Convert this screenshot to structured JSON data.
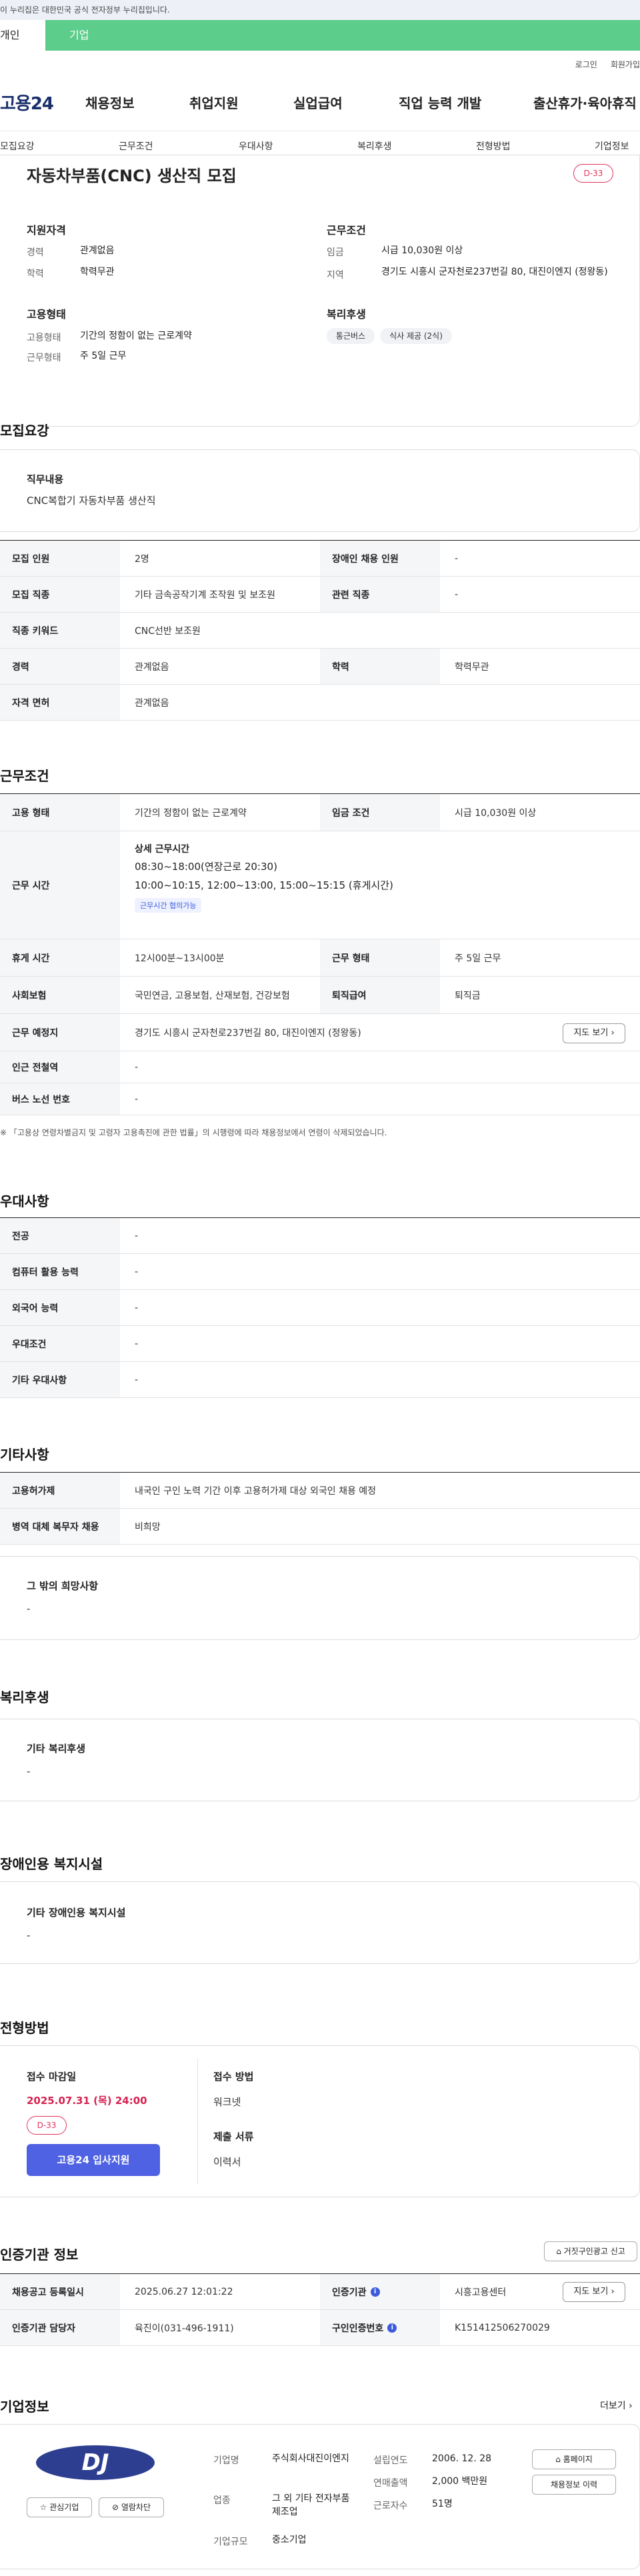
{
  "banner": {
    "text": "이 누리집은 대한민국 공식 전자정부 누리집입니다."
  },
  "tabs": {
    "person": "개인",
    "company": "기업"
  },
  "util": {
    "login": "로그인",
    "join": "회원가입"
  },
  "logo": "고용24",
  "gnb": [
    "채용정보",
    "취업지원",
    "실업급여",
    "직업 능력 개발",
    "출산휴가·육아휴직"
  ],
  "snb": [
    "모집요강",
    "근무조건",
    "우대사항",
    "복리후생",
    "전형방법",
    "기업정보"
  ],
  "job": {
    "title": "자동차부품(CNC) 생산직 모집",
    "dday": "D-33",
    "qual_label": "지원자격",
    "career_k": "경력",
    "career_v": "관계없음",
    "edu_k": "학력",
    "edu_v": "학력무관",
    "emp_label": "고용형태",
    "emp_type_k": "고용형태",
    "emp_type_v": "기간의 정함이 없는 근로계약",
    "work_type_k": "근무형태",
    "work_type_v": "주 5일 근무",
    "cond_label": "근무조건",
    "wage_k": "임금",
    "wage_v": "시급 10,030원 이상",
    "region_k": "지역",
    "region_v": "경기도 시흥시 군자천로237번길 80, 대진이엔지 (정왕동)",
    "welfare_label": "복리후생",
    "chips": [
      "통근버스",
      "식사 제공 (2식)"
    ]
  },
  "recruit": {
    "title": "모집요강",
    "duty_label": "직무내용",
    "duty_text": "CNC복합기 자동차부품 생산직",
    "rows": [
      {
        "k1": "모집 인원",
        "v1": "2명",
        "k2": "장애인 채용 인원",
        "v2": "-"
      },
      {
        "k1": "모집 직종",
        "v1": "기타 금속공작기계 조작원 및 보조원",
        "k2": "관련 직종",
        "v2": "-"
      },
      {
        "k1": "직종 키워드",
        "v1": "CNC선반 보조원"
      },
      {
        "k1": "경력",
        "v1": "관계없음",
        "k2": "학력",
        "v2": "학력무관"
      },
      {
        "k1": "자격 면허",
        "v1": "관계없음"
      }
    ]
  },
  "conditions": {
    "title": "근무조건",
    "emp_k": "고용 형태",
    "emp_v": "기간의 정함이 없는 근로계약",
    "wage_k": "임금 조건",
    "wage_v": "시급 10,030원 이상",
    "hours_k": "근무 시간",
    "hours_detail_label": "상세 근무시간",
    "hours_line1": "08:30~18:00(연장근로 20:30)",
    "hours_line2": "10:00~10:15, 12:00~13:00, 15:00~15:15 (휴게시간)",
    "hours_badge": "근무시간 협의가능",
    "break_k": "휴게 시간",
    "break_v": "12시00분~13시00분",
    "worktype_k": "근무 형태",
    "worktype_v": "주 5일 근무",
    "ins_k": "사회보험",
    "ins_v": "국민연금, 고용보험, 산재보험, 건강보험",
    "retire_k": "퇴직급여",
    "retire_v": "퇴직금",
    "place_k": "근무 예정지",
    "place_v": "경기도 시흥시 군자천로237번길 80, 대진이엔지 (정왕동)",
    "map_btn": "지도 보기",
    "subway_k": "인근 전철역",
    "subway_v": "-",
    "bus_k": "버스 노선 번호",
    "bus_v": "-",
    "note": "※ 「고용상 연령차별금지 및 고령자 고용촉진에 관한 법률」의 시행령에 따라 채용정보에서 연령이 삭제되었습니다."
  },
  "prefer": {
    "title": "우대사항",
    "rows": [
      {
        "k": "전공",
        "v": "-"
      },
      {
        "k": "컴퓨터 활용 능력",
        "v": "-"
      },
      {
        "k": "외국어 능력",
        "v": "-"
      },
      {
        "k": "우대조건",
        "v": "-"
      },
      {
        "k": "기타 우대사항",
        "v": "-"
      }
    ]
  },
  "etc": {
    "title": "기타사항",
    "foreign_k": "고용허가제",
    "foreign_v": "내국인 구인 노력 기간 이후 고용허가제 대상 외국인 채용 예정",
    "military_k": "병역 대체 복무자 채용",
    "military_v": "비희망",
    "hope_label": "그 밖의 희망사항",
    "hope_v": "-"
  },
  "welfare": {
    "title": "복리후생",
    "label": "기타 복리후생",
    "v": "-"
  },
  "disabled": {
    "title": "장애인용 복지시설",
    "label": "기타 장애인용 복지시설",
    "v": "-"
  },
  "selection": {
    "title": "전형방법",
    "deadline_label": "접수 마감일",
    "deadline": "2025.07.31 (목) 24:00",
    "dday": "D-33",
    "apply_btn": "고용24 입사지원",
    "method_label": "접수 방법",
    "method_v": "워크넷",
    "docs_label": "제출 서류",
    "docs_v": "이력서"
  },
  "agency": {
    "title": "인증기관 정보",
    "report_btn": "거짓구인광고 신고",
    "reg_k": "채용공고 등록일시",
    "reg_v": "2025.06.27 12:01:22",
    "org_k": "인증기관",
    "org_v": "시흥고용센터",
    "map_btn": "지도 보기",
    "mgr_k": "인증기관 담당자",
    "mgr_v": "육진이(031-496-1911)",
    "no_k": "구인인증번호",
    "no_v": "K151412506270029",
    "info_icon": "i"
  },
  "company": {
    "title": "기업정보",
    "more": "더보기",
    "logo_text": "DJ",
    "fav_btn": "관심기업",
    "block_btn": "열람차단",
    "name_k": "기업명",
    "name_v": "주식회사대진이엔지",
    "biz_k": "업종",
    "biz_v": "그 외 기타 전자부품 제조업",
    "size_k": "기업규모",
    "size_v": "중소기업",
    "found_k": "설립연도",
    "found_v": "2006. 12. 28",
    "sales_k": "연매출액",
    "sales_v": "2,000 백만원",
    "emp_k": "근로자수",
    "emp_v": "51명",
    "home_btn": "홈페이지",
    "history_btn": "채용정보 이력"
  }
}
